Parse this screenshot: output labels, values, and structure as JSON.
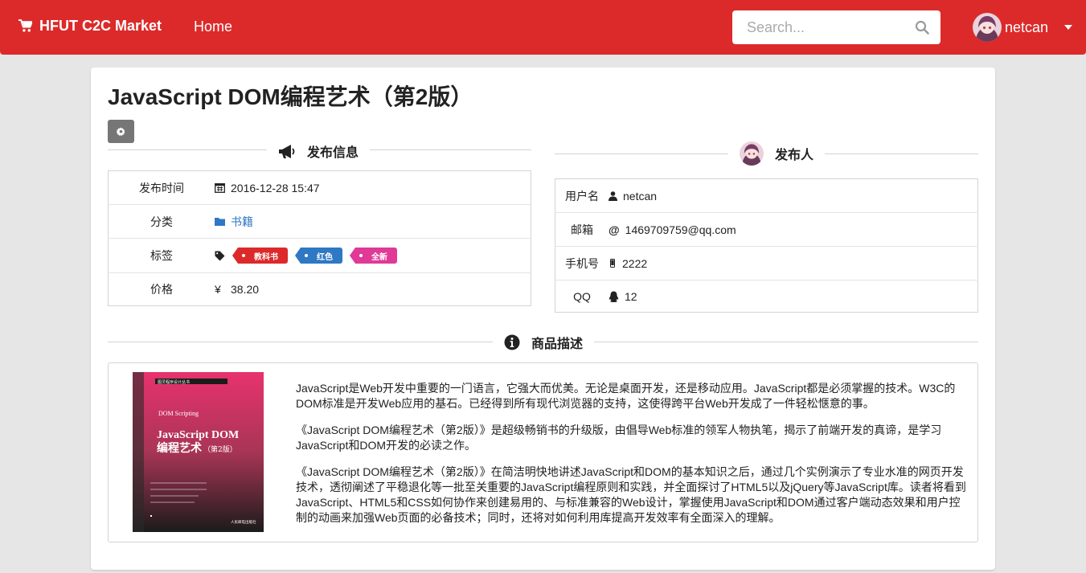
{
  "navbar": {
    "brand": "HFUT C2C Market",
    "home": "Home",
    "search_placeholder": "Search...",
    "username": "netcan"
  },
  "product": {
    "title": "JavaScript DOM编程艺术（第2版）",
    "publish_section": "发布信息",
    "rows": {
      "time_label": "发布时间",
      "time_value": "2016-12-28 15:47",
      "category_label": "分类",
      "category_value": "书籍",
      "tags_label": "标签",
      "tags": [
        "教科书",
        "红色",
        "全新"
      ],
      "tag_colors": [
        "#dc2a2a",
        "#2f78c4",
        "#e03997"
      ],
      "price_label": "价格",
      "price_currency": "¥",
      "price_value": "38.20"
    }
  },
  "publisher": {
    "section": "发布人",
    "username_label": "用户名",
    "username": "netcan",
    "email_label": "邮箱",
    "email": "1469709759@qq.com",
    "phone_label": "手机号",
    "phone": "2222",
    "qq_label": "QQ",
    "qq": "12"
  },
  "description": {
    "section": "商品描述",
    "paragraphs": [
      "JavaScript是Web开发中重要的一门语言，它强大而优美。无论是桌面开发，还是移动应用。JavaScript都是必须掌握的技术。W3C的DOM标准是开发Web应用的基石。已经得到所有现代浏览器的支持，这使得跨平台Web开发成了一件轻松惬意的事。",
      "《JavaScript DOM编程艺术（第2版）》是超级畅销书的升级版，由倡导Web标准的领军人物执笔，揭示了前端开发的真谛，是学习JavaScript和DOM开发的必读之作。",
      "《JavaScript DOM编程艺术（第2版）》在简洁明快地讲述JavaScript和DOM的基本知识之后，通过几个实例演示了专业水准的网页开发技术，透彻阐述了平稳退化等一批至关重要的JavaScript编程原则和实践，并全面探讨了HTML5以及jQuery等JavaScript库。读者将看到JavaScript、HTML5和CSS如何协作来创建易用的、与标准兼容的Web设计，掌握使用JavaScript和DOM通过客户端动态效果和用户控制的动画来加强Web页面的必备技术；同时，还将对如何利用库提高开发效率有全面深入的理解。"
    ],
    "book_cover": {
      "series": "图灵程序设计丛书",
      "subtitle_en": "DOM Scripting",
      "title_cn_1": "JavaScript DOM",
      "title_cn_2": "编程艺术",
      "edition": "（第2版）",
      "publisher": "人民邮电出版社"
    }
  },
  "colors": {
    "accent": "#dc2a2a",
    "link": "#2f78c4"
  }
}
